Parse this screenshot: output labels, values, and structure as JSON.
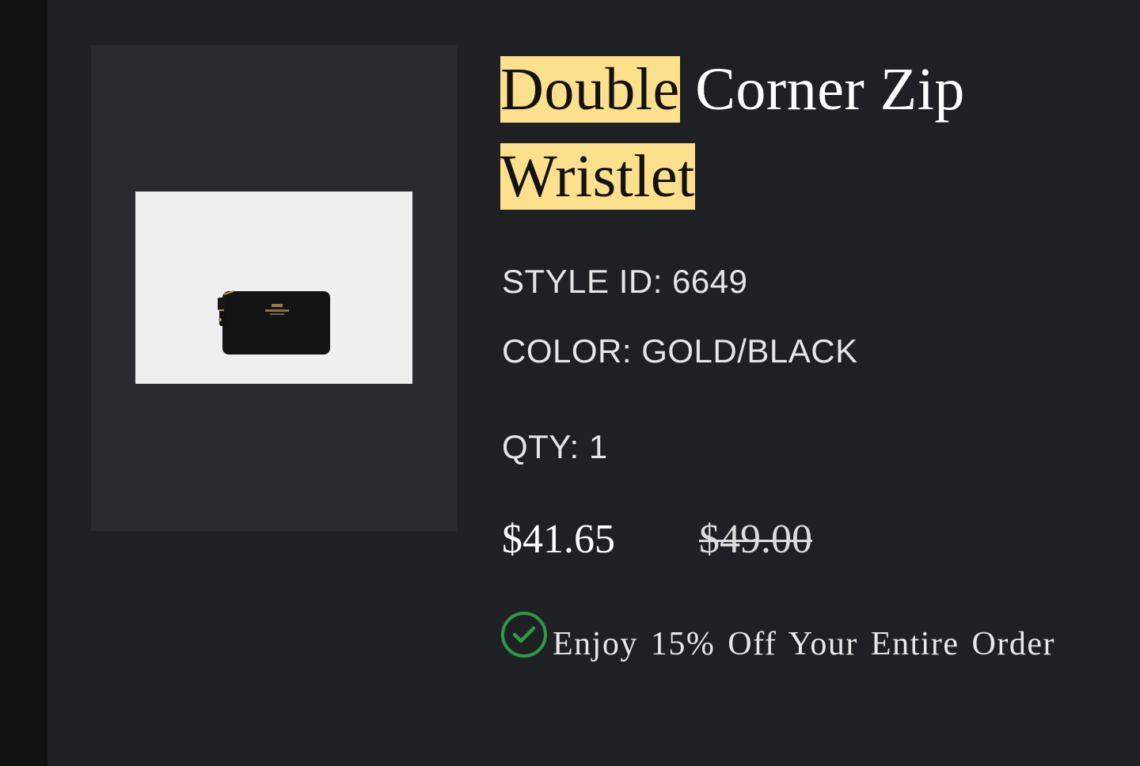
{
  "product": {
    "title_highlight_1": "Double",
    "title_rest_1": "Corner Zip",
    "title_highlight_2": "Wristlet",
    "image_label": "product photo of black double corner zip wristlet",
    "style_id": "STYLE ID: 6649",
    "color": "COLOR: GOLD/BLACK",
    "qty": "QTY: 1",
    "price_sale": "$41.65",
    "price_original": "$49.00",
    "promo_text": "Enjoy 15% Off Your Entire Order",
    "promo_icon": "check-circle-icon"
  },
  "colors": {
    "highlight": "#fde08c",
    "panel_bg": "#1f2024",
    "image_frame_bg": "#2a2b2e",
    "promo_check": "#2f9a45"
  }
}
